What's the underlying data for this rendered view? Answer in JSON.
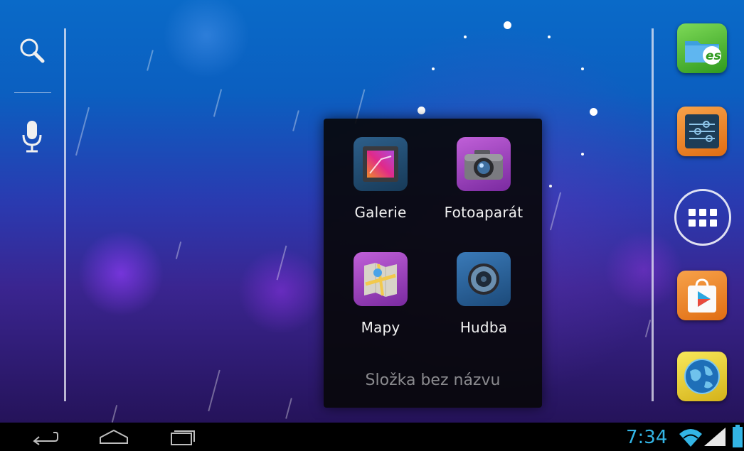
{
  "left_bar": {
    "search_icon": "search-icon",
    "voice_icon": "microphone-icon"
  },
  "folder": {
    "name": "Složka bez názvu",
    "apps": [
      {
        "label": "Galerie",
        "icon": "gallery-icon"
      },
      {
        "label": "Fotoaparát",
        "icon": "camera-icon"
      },
      {
        "label": "Mapy",
        "icon": "maps-icon"
      },
      {
        "label": "Hudba",
        "icon": "music-icon"
      }
    ]
  },
  "dock": {
    "items": [
      {
        "icon": "es-file-explorer-icon"
      },
      {
        "icon": "settings-icon"
      },
      {
        "icon": "all-apps-icon"
      },
      {
        "icon": "play-store-icon"
      },
      {
        "icon": "browser-globe-icon"
      }
    ]
  },
  "status_bar": {
    "time": "7:34",
    "wifi_icon": "wifi-icon",
    "signal_icon": "signal-icon",
    "battery_icon": "battery-icon",
    "accent": "#33b5e5"
  },
  "navigation": {
    "back_icon": "back-icon",
    "home_icon": "home-icon",
    "recents_icon": "recent-apps-icon"
  }
}
